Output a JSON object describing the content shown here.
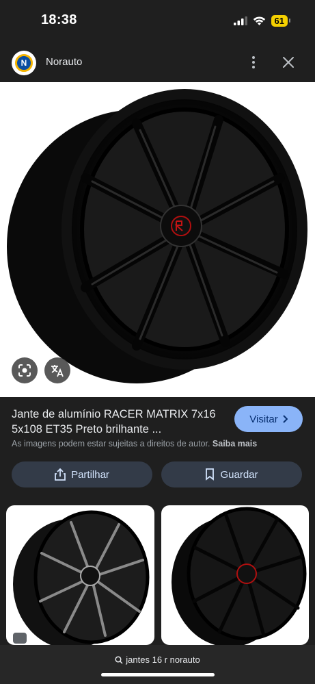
{
  "status_bar": {
    "time": "18:38",
    "battery": "61"
  },
  "header": {
    "site_name": "Norauto",
    "logo_letter": "N"
  },
  "result": {
    "title": "Jante de alumínio RACER MATRIX 7x16 5x108 ET35 Preto brilhante ...",
    "visit_label": "Visitar",
    "copyright_text": "As imagens podem estar sujeitas a direitos de autor.",
    "copyright_link": "Saiba mais",
    "share_label": "Partilhar",
    "save_label": "Guardar"
  },
  "search": {
    "query": "jantes 16 r norauto"
  },
  "colors": {
    "background": "#1f1f1f",
    "accent": "#8ab4f8",
    "chip": "#333b48"
  },
  "icons": [
    "wifi-icon",
    "signal-icon",
    "more-icon",
    "close-icon",
    "lens-icon",
    "translate-icon",
    "share-icon",
    "bookmark-icon",
    "search-icon",
    "chevron-right-icon"
  ]
}
